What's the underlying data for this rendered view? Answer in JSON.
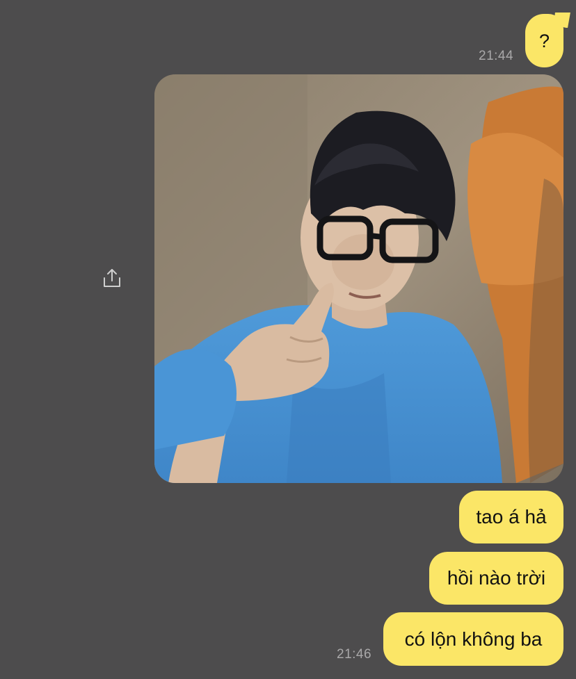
{
  "messages": [
    {
      "text": "?",
      "time": "21:44"
    },
    {
      "type": "photo"
    },
    {
      "text": "tao á hả"
    },
    {
      "text": "hồi nào trời"
    },
    {
      "text": "có lộn không ba",
      "time": "21:46"
    }
  ],
  "icons": {
    "share": "share-icon"
  },
  "colors": {
    "background": "#4d4c4d",
    "bubble": "#fbe667",
    "timestamp": "#a9a8a9"
  }
}
